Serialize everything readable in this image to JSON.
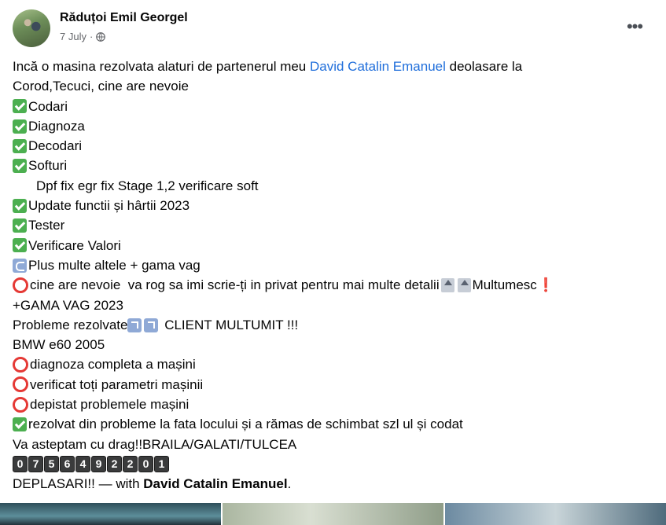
{
  "post": {
    "author": "Răduțoi Emil Georgel",
    "date": "7 July",
    "separator": "·",
    "privacy_icon": "globe-icon",
    "menu_icon": "more-options-icon",
    "more_label": "•••"
  },
  "body": {
    "intro_pre": "Incă o masina rezolvata alaturi de partenerul meu ",
    "intro_link": "David Catalin Emanuel",
    "intro_post": " deolasare la",
    "intro_line2": "Corod,Tecuci, cine are nevoie",
    "item_codari": "Codari",
    "item_diagnoza": "Diagnoza",
    "item_decodari": "Decodari",
    "item_softuri": "Softuri",
    "item_softuri_detail": "Dpf fix egr fix Stage 1,2 verificare soft",
    "item_update": "Update functii și hârtii 2023",
    "item_tester": "Tester",
    "item_valori": "Verificare Valori",
    "item_plus": "Plus multe altele + gama vag",
    "item_contact": "cine are nevoie  va rog sa imi scrie-ți in privat pentru mai multe detalii",
    "thanks": "Multumesc",
    "exclamation": "❗",
    "gama": "+GAMA VAG 2023",
    "probleme_pre": "Probleme rezolvate",
    "probleme_post": " CLIENT MULTUMIT !!!",
    "car": "BMW e60 2005",
    "diag": "diagnoza completa a mașini",
    "param": "verificat toți parametri mașinii",
    "depistat": "depistat problemele mașini",
    "rezolvat": "rezolvat din probleme la fata locului și a rămas de schimbat szl ul și codat",
    "asteptam": "Va asteptam cu drag!!BRAILA/GALATI/TULCEA",
    "phone_digits": [
      "0",
      "7",
      "5",
      "6",
      "4",
      "9",
      "2",
      "2",
      "0",
      "1"
    ],
    "deplasari_pre": "DEPLASARI!! — with ",
    "deplasari_name": "David Catalin Emanuel",
    "deplasari_post": "."
  },
  "icons": {
    "check": "check-mark-button-emoji",
    "ring": "hollow-red-circle-emoji",
    "loop": "loop-arrow-emoji",
    "top": "top-arrow-emoji",
    "arrow": "up-right-arrow-emoji"
  },
  "colors": {
    "link": "#216fdb",
    "meta": "#65676b",
    "check_green": "#4caf50",
    "ring_red": "#e53935"
  }
}
